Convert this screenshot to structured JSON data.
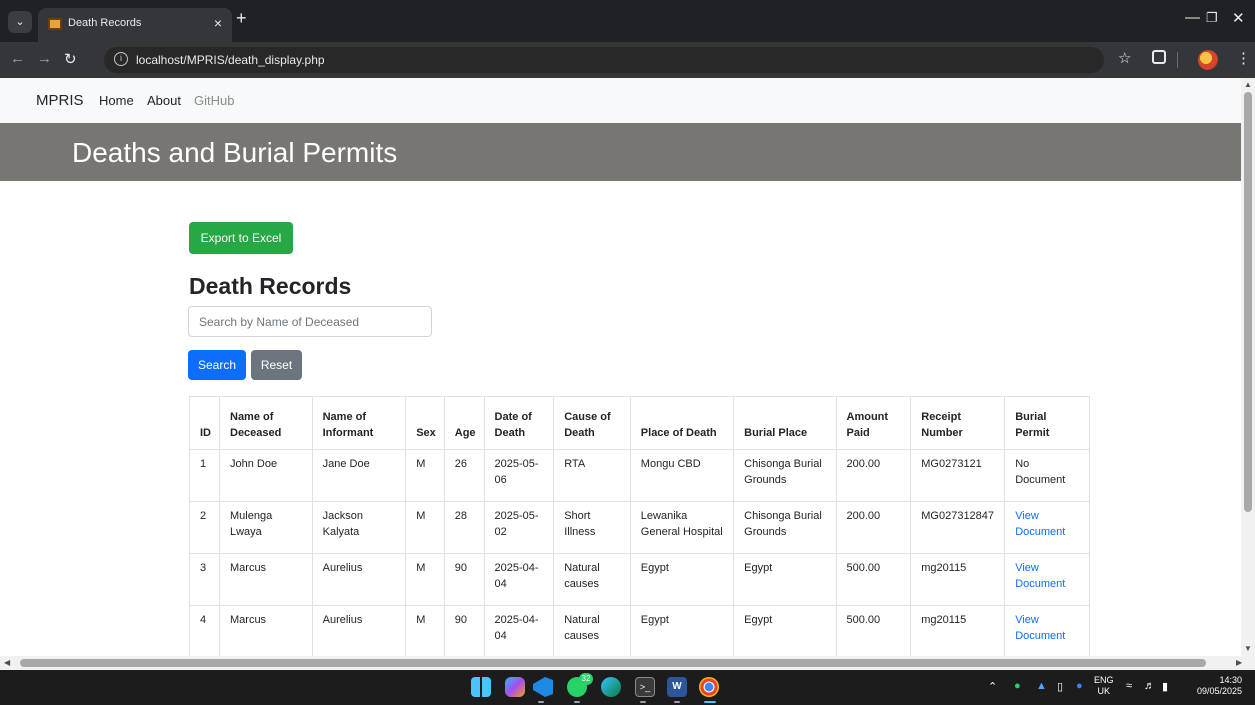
{
  "browser": {
    "tab_title": "Death Records",
    "url": "localhost/MPRIS/death_display.php",
    "new_tab_glyph": "+",
    "tab_close_glyph": "×"
  },
  "navbar": {
    "brand": "MPRIS",
    "links": [
      "Home",
      "About",
      "GitHub"
    ]
  },
  "hero": {
    "title": "Deaths and Burial Permits"
  },
  "page": {
    "export_button": "Export to Excel",
    "heading": "Death Records",
    "search_placeholder": "Search by Name of Deceased",
    "search_button": "Search",
    "reset_button": "Reset"
  },
  "table": {
    "headers": [
      "ID",
      "Name of Deceased",
      "Name of Informant",
      "Sex",
      "Age",
      "Date of Death",
      "Cause of Death",
      "Place of Death",
      "Burial Place",
      "Amount Paid",
      "Receipt Number",
      "Burial Permit"
    ],
    "rows": [
      [
        "1",
        "John Doe",
        "Jane Doe",
        "M",
        "26",
        "2025-05-06",
        "RTA",
        "Mongu CBD",
        "Chisonga Burial Grounds",
        "200.00",
        "MG0273121",
        "No Document"
      ],
      [
        "2",
        "Mulenga Lwaya",
        "Jackson Kalyata",
        "M",
        "28",
        "2025-05-02",
        "Short Illness",
        "Lewanika General Hospital",
        "Chisonga Burial Grounds",
        "200.00",
        "MG027312847",
        "View Document"
      ],
      [
        "3",
        "Marcus",
        "Aurelius",
        "M",
        "90",
        "2025-04-04",
        "Natural causes",
        "Egypt",
        "Egypt",
        "500.00",
        "mg20115",
        "View Document"
      ],
      [
        "4",
        "Marcus",
        "Aurelius",
        "M",
        "90",
        "2025-04-04",
        "Natural causes",
        "Egypt",
        "Egypt",
        "500.00",
        "mg20115",
        "View Document"
      ]
    ]
  },
  "taskbar": {
    "whatsapp_badge": "32",
    "language": "ENG",
    "region": "UK",
    "time": "14:30",
    "date": "09/05/2025"
  },
  "colors": {
    "hero_bg": "#787672",
    "excel_button": "#28a745",
    "search_button": "#0d6efd",
    "reset_button": "#6c757d",
    "link": "#0d6efd"
  }
}
